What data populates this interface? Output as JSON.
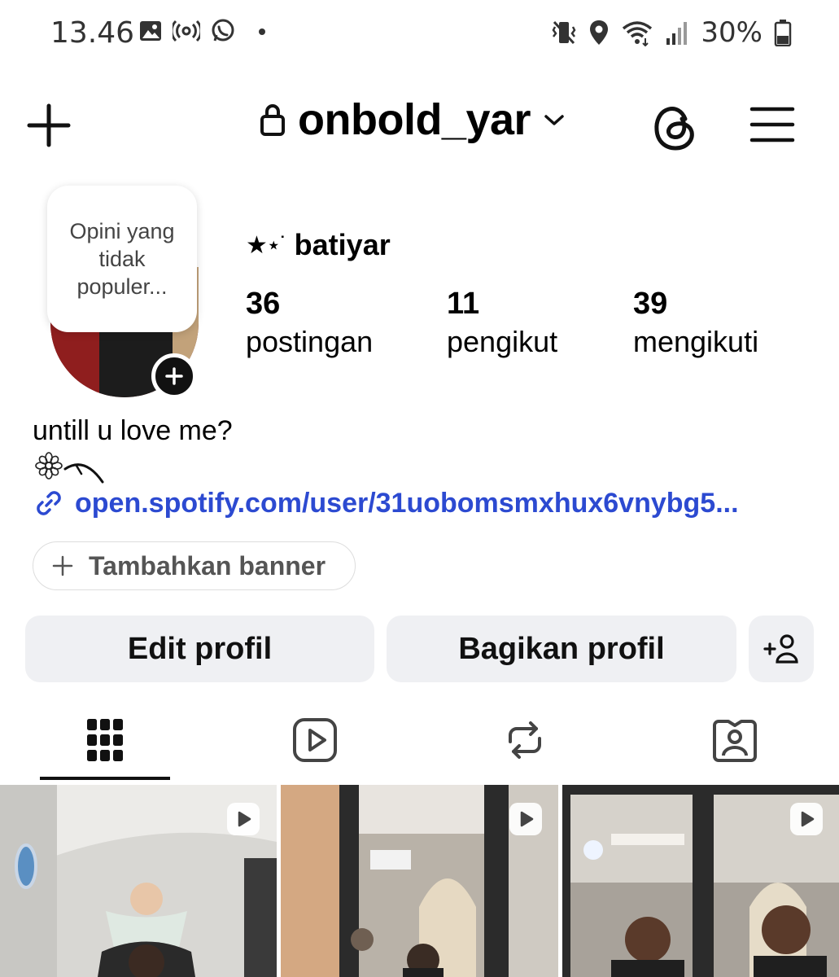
{
  "status_bar": {
    "time": "13.46",
    "battery": "30%",
    "left_icons": [
      "gallery-icon",
      "broadcast-icon",
      "whatsapp-icon",
      "dot-icon"
    ],
    "right_icons": [
      "vibrate-icon",
      "location-icon",
      "wifi-icon",
      "signal-icon",
      "battery-icon"
    ]
  },
  "top_bar": {
    "username": "onbold_yar",
    "icons": [
      "plus-icon",
      "lock-icon",
      "chevron-down-icon",
      "threads-icon",
      "menu-icon"
    ]
  },
  "profile": {
    "note": "Opini yang tidak populer...",
    "display_name": "batiyar",
    "display_name_prefix": "★⋆˙",
    "stats": [
      {
        "value": "36",
        "label": "postingan"
      },
      {
        "value": "11",
        "label": "pengikut"
      },
      {
        "value": "39",
        "label": "mengikuti"
      }
    ],
    "bio": "untill u love me?",
    "link": "open.spotify.com/user/31uobomsmxhux6vnybg5..."
  },
  "buttons": {
    "banner": "Tambahkan banner",
    "edit": "Edit profil",
    "share": "Bagikan profil"
  },
  "tabs": [
    "grid-icon",
    "reels-icon",
    "reposts-icon",
    "tagged-icon"
  ],
  "colors": {
    "link": "#2c4ad1",
    "button_bg": "#eff0f3",
    "text": "#000000"
  }
}
